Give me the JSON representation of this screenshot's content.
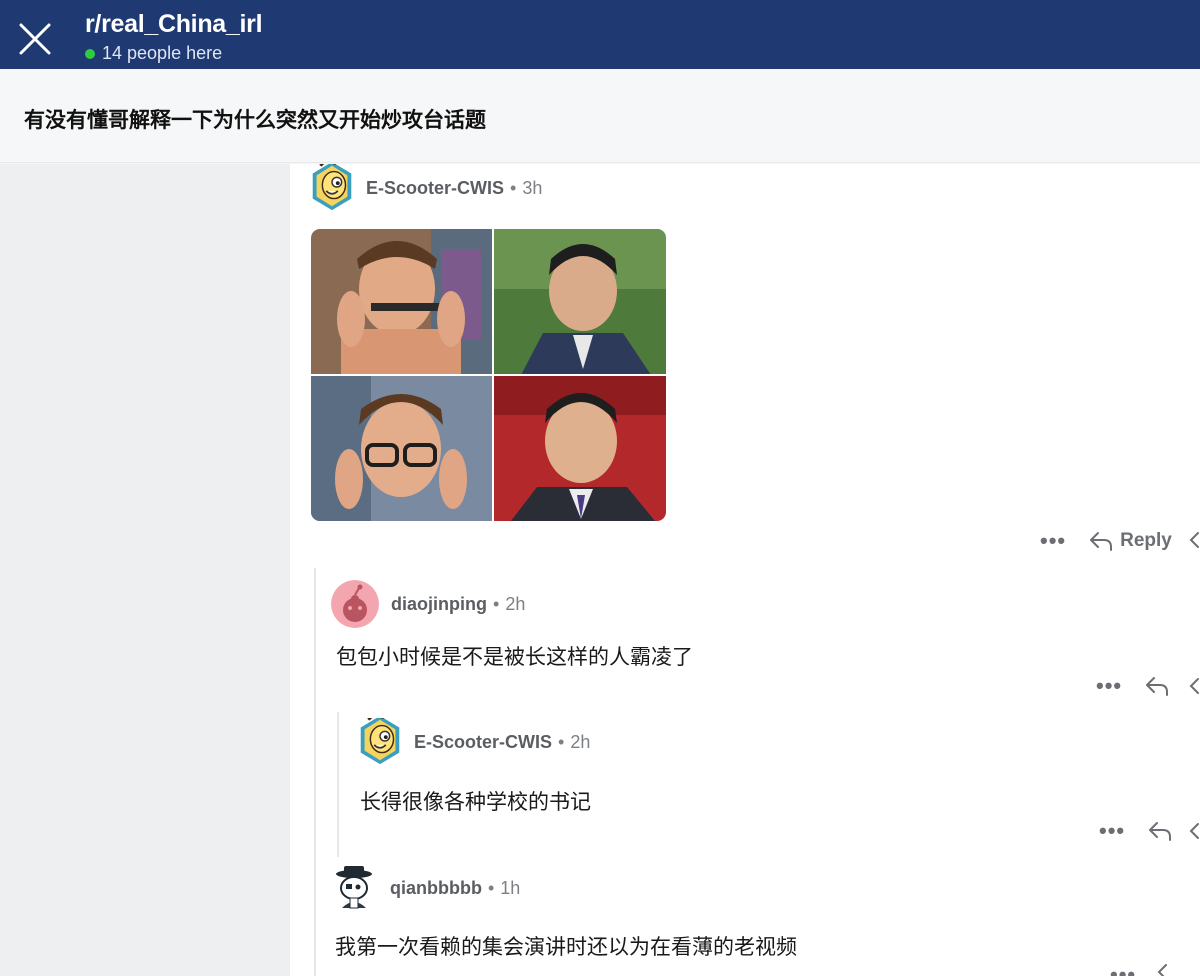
{
  "header": {
    "subreddit": "r/real_China_irl",
    "online": "14 people here"
  },
  "post": {
    "title": "有没有懂哥解释一下为什么突然又开始炒攻台话题"
  },
  "comments": [
    {
      "author": "E-Scooter-CWIS",
      "time": "3h",
      "reply_label": "Reply",
      "has_image": true,
      "image_desc_icon": "meme-image"
    },
    {
      "author": "diaojinping",
      "time": "2h",
      "body": "包包小时候是不是被长这样的人霸凌了"
    },
    {
      "author": "E-Scooter-CWIS",
      "time": "2h",
      "body": "长得很像各种学校的书记"
    },
    {
      "author": "qianbbbbb",
      "time": "1h",
      "body": "我第一次看赖的集会演讲时还以为在看薄的老视频"
    }
  ],
  "ui": {
    "separator": "•",
    "more": "•••"
  },
  "colors": {
    "topbar": "#1f3a73",
    "online_dot": "#2ecc40",
    "meta_text": "#7c7f83"
  }
}
